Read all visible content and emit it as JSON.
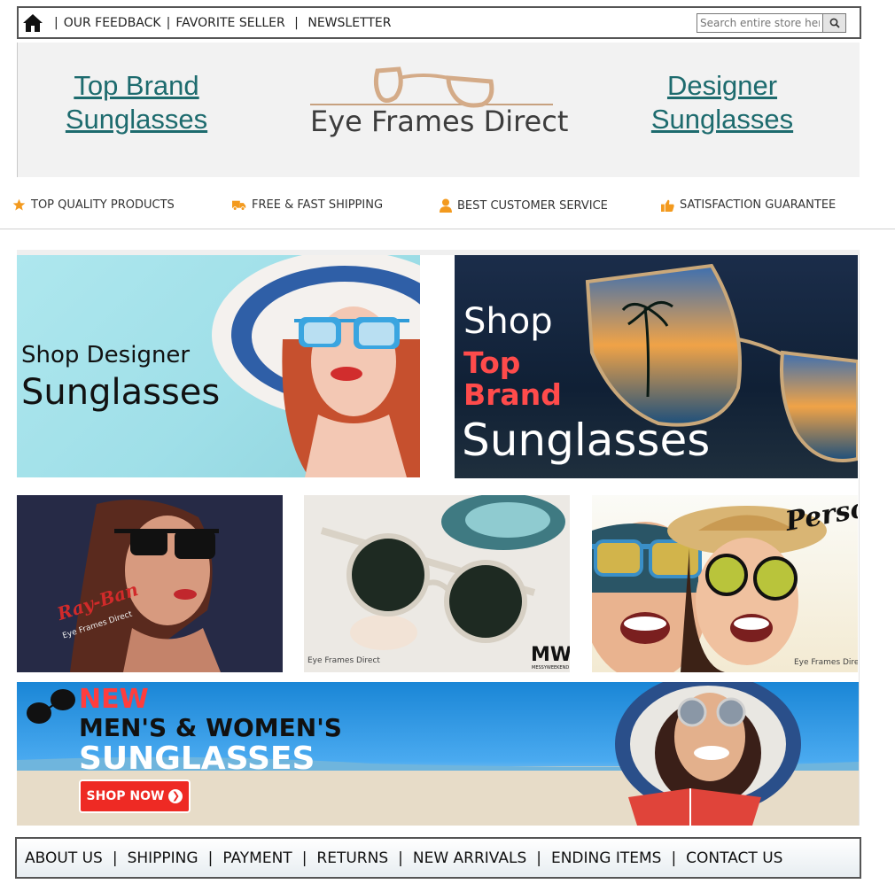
{
  "topbar": {
    "links": [
      "OUR FEEDBACK",
      "FAVORITE SELLER",
      "NEWSLETTER"
    ],
    "search_placeholder": "Search entire store here..."
  },
  "header": {
    "left_link_line1": "Top Brand",
    "left_link_line2": "Sunglasses",
    "logo_text": "Eye Frames Direct",
    "right_link_line1": "Designer",
    "right_link_line2": "Sunglasses"
  },
  "features": [
    {
      "icon": "star-icon",
      "label": "TOP QUALITY PRODUCTS"
    },
    {
      "icon": "truck-icon",
      "label": "FREE & FAST SHIPPING"
    },
    {
      "icon": "user-icon",
      "label": "BEST CUSTOMER SERVICE"
    },
    {
      "icon": "thumbs-up-icon",
      "label": "SATISFACTION GUARANTEE"
    }
  ],
  "tiles": {
    "designer": {
      "line1": "Shop Designer",
      "line2": "Sunglasses"
    },
    "topbrand": {
      "line1": "Shop",
      "line2": "Top",
      "line3": "Brand",
      "line4": "Sunglasses"
    },
    "rayban": {
      "brand": "Ray-Ban",
      "watermark": "Eye Frames Direct"
    },
    "mw": {
      "watermark": "Eye Frames Direct",
      "brand": "MW",
      "brand_sub": "MESSYWEEKEND"
    },
    "persol": {
      "brand": "Persol",
      "watermark": "Eye Frames Direct"
    },
    "new_arrivals": {
      "line1": "NEW",
      "line2": "MEN'S & WOMEN'S",
      "line3": "SUNGLASSES",
      "button": "SHOP NOW"
    }
  },
  "footer_nav": [
    "ABOUT US",
    "SHIPPING",
    "PAYMENT",
    "RETURNS",
    "NEW ARRIVALS",
    "ENDING ITEMS",
    "CONTACT US"
  ],
  "colors": {
    "header_link": "#1d6b6e",
    "feature_icon": "#f39a1e",
    "accent_red": "#ff4b4b",
    "button_red": "#ee2a24"
  }
}
